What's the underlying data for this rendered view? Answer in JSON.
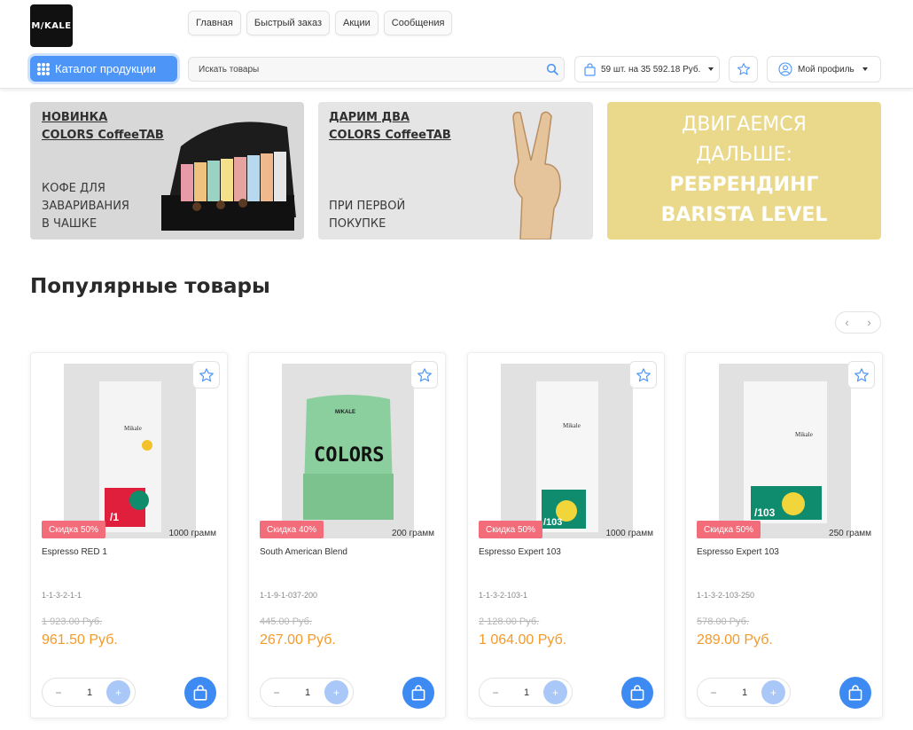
{
  "header": {
    "logo_text": "M/KALE",
    "nav": [
      "Главная",
      "Быстрый заказ",
      "Акции",
      "Сообщения"
    ],
    "catalog_label": "Каталог продукции",
    "search_placeholder": "Искать товары",
    "cart_summary": "59 шт. на 35 592.18 Руб.",
    "profile_label": "Мой профиль"
  },
  "banners": [
    {
      "title_1": "НОВИНКА",
      "title_2": "COLORS CoffeeTAB",
      "sub_1": "КОФЕ ДЛЯ",
      "sub_2": "ЗАВАРИВАНИЯ",
      "sub_3": "В ЧАШКЕ",
      "background": "#d8d8d8"
    },
    {
      "title_1": "ДАРИМ ДВА",
      "title_2": "COLORS CoffeeTAB",
      "sub_1": "ПРИ ПЕРВОЙ",
      "sub_2": "ПОКУПКЕ",
      "background": "#e5e5e5"
    },
    {
      "line_1": "ДВИГАЕМСЯ",
      "line_2": "ДАЛЬШЕ:",
      "line_3": "РЕБРЕНДИНГ",
      "line_4": "BARISTA LEVEL",
      "background": "#ead98b"
    }
  ],
  "section_title": "Популярные товары",
  "products": [
    {
      "discount": "Скидка 50%",
      "weight": "1000 грамм",
      "name": "Espresso RED 1",
      "sku": "1-1-3-2-1-1",
      "old_price": "1 923.00 Руб.",
      "price": "961.50 Руб.",
      "qty": "1",
      "bag_brand": "Mikale",
      "bag_label": "/1"
    },
    {
      "discount": "Скидка 40%",
      "weight": "200 грамм",
      "name": "South American Blend",
      "sku": "1-1-9-1-037-200",
      "old_price": "445.00 Руб.",
      "price": "267.00 Руб.",
      "qty": "1",
      "bag_brand": "M/KALE",
      "bag_label": "COLORS"
    },
    {
      "discount": "Скидка 50%",
      "weight": "1000 грамм",
      "name": "Espresso Expert 103",
      "sku": "1-1-3-2-103-1",
      "old_price": "2 128.00 Руб.",
      "price": "1 064.00 Руб.",
      "qty": "1",
      "bag_brand": "Mikale",
      "bag_label": "/103"
    },
    {
      "discount": "Скидка 50%",
      "weight": "250 грамм",
      "name": "Espresso Expert 103",
      "sku": "1-1-3-2-103-250",
      "old_price": "578.00 Руб.",
      "price": "289.00 Руб.",
      "qty": "1",
      "bag_brand": "Mikale",
      "bag_label": "/103"
    }
  ],
  "colors": {
    "accent": "#3d8bf2",
    "price": "#f39a2b",
    "discount_badge": "#f26c7a"
  }
}
